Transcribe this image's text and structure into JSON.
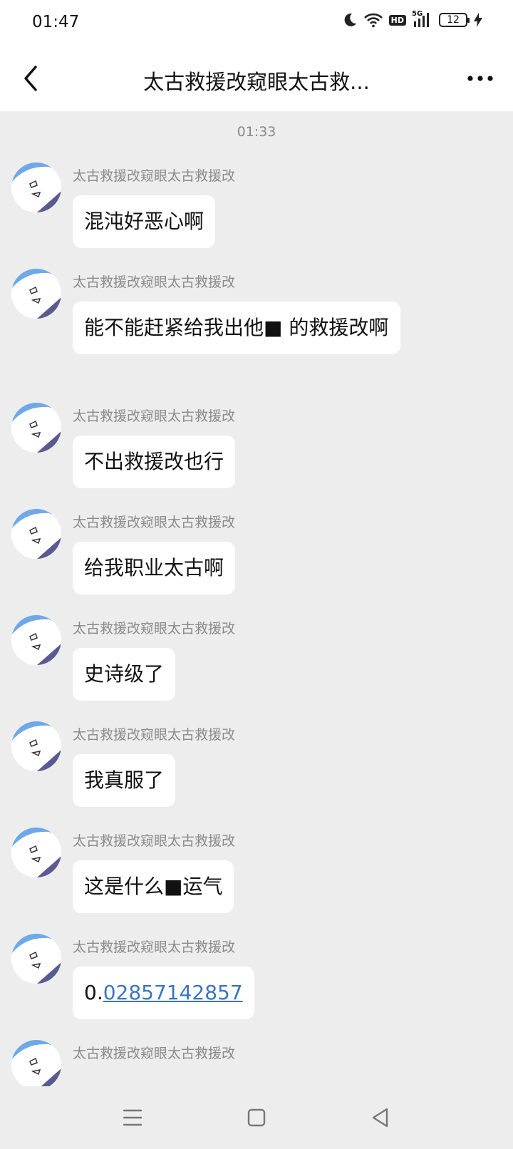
{
  "status_bar": {
    "time": "01:47",
    "network_label": "5G",
    "hd_label": "HD",
    "battery_level": "12",
    "icons": [
      "moon-icon",
      "wifi-icon",
      "hd-icon",
      "signal-icon",
      "battery-icon",
      "charging-icon"
    ]
  },
  "header": {
    "title": "太古救援改窥眼太古救...",
    "back_icon": "chevron-left-icon",
    "more_icon": "more-dots-icon"
  },
  "chat": {
    "timestamp": "01:33",
    "messages": [
      {
        "sender": "太古救援改窥眼太古救援改",
        "text": "混沌好恶心啊"
      },
      {
        "sender": "太古救援改窥眼太古救援改",
        "text": "能不能赶紧给我出他■ 的救援改啊"
      },
      {
        "sender": "太古救援改窥眼太古救援改",
        "text": "不出救援改也行"
      },
      {
        "sender": "太古救援改窥眼太古救援改",
        "text": "给我职业太古啊"
      },
      {
        "sender": "太古救援改窥眼太古救援改",
        "text": "史诗级了"
      },
      {
        "sender": "太古救援改窥眼太古救援改",
        "text": "我真服了"
      },
      {
        "sender": "太古救援改窥眼太古救援改",
        "text": "这是什么■运气"
      },
      {
        "sender": "太古救援改窥眼太古救援改",
        "text_prefix": "0.",
        "link_text": "02857142857"
      },
      {
        "sender": "太古救援改窥眼太古救援改"
      }
    ]
  },
  "bottom_nav": {
    "icons": [
      "menu-icon",
      "home-square-icon",
      "back-triangle-icon"
    ]
  }
}
